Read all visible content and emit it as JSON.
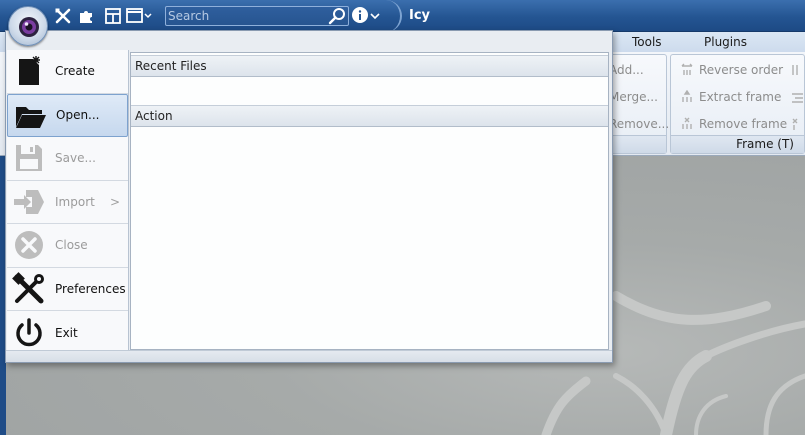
{
  "titlebar": {
    "title": "Icy",
    "search_placeholder": "Search",
    "quick_access_icons": [
      "tools-icon",
      "puzzle-icon",
      "layout-icon",
      "window-icon"
    ],
    "colors": {
      "bar": "#245592",
      "accent": "#7da2ce"
    }
  },
  "ribbon": {
    "tabs": [
      {
        "label": "Tools"
      },
      {
        "label": "Plugins"
      }
    ],
    "group_items_left": [
      "Add...",
      "Merge...",
      "Remove..."
    ],
    "frame_group": {
      "label": "Frame (T)",
      "items": [
        "Reverse order",
        "Extract frame",
        "Remove frame"
      ]
    }
  },
  "app_menu": {
    "items": [
      {
        "label": "Create",
        "icon": "new-file-icon",
        "disabled": false
      },
      {
        "label": "Open...",
        "icon": "folder-open-icon",
        "disabled": false,
        "selected": true
      },
      {
        "label": "Save...",
        "icon": "floppy-disk-icon",
        "disabled": true
      },
      {
        "label": "Import",
        "icon": "import-icon",
        "disabled": true,
        "submenu_arrow": ">"
      },
      {
        "label": "Close",
        "icon": "close-circle-icon",
        "disabled": true
      },
      {
        "label": "Preferences",
        "icon": "tools-icon",
        "disabled": false
      },
      {
        "label": "Exit",
        "icon": "power-icon",
        "disabled": false
      }
    ],
    "sections": {
      "recent_files": "Recent Files",
      "action": "Action"
    }
  }
}
